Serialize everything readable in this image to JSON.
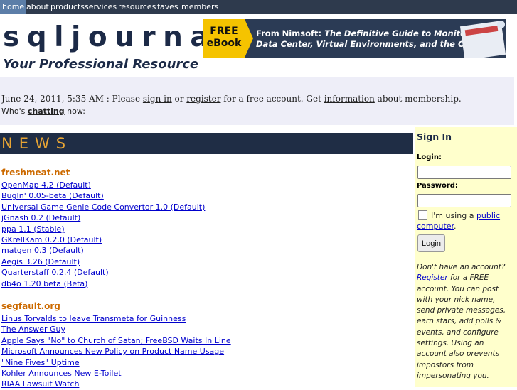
{
  "nav": {
    "items": [
      {
        "label": "home",
        "active": true
      },
      {
        "label": "about",
        "active": false
      },
      {
        "label": "products",
        "active": false
      },
      {
        "label": "services",
        "active": false
      },
      {
        "label": "resources",
        "active": false
      },
      {
        "label": "faves",
        "active": false
      },
      {
        "label": "members",
        "active": false
      }
    ]
  },
  "header": {
    "logo_text": "sqljournal",
    "tagline": "Your Professional Resource"
  },
  "banner": {
    "badge_line1": "FREE",
    "badge_line2": "eBook",
    "line1_prefix": "From Nimsoft: ",
    "line1_title": "The Definitive Guide to Monitoring the",
    "line2_title": "Data Center, Virtual Environments, and the Cloud",
    "close_icon": "ad-info-icon"
  },
  "info": {
    "date_text": "June 24, 2011, 5:35 AM : Please ",
    "sign_in": "sign in",
    "or_text": " or ",
    "register": "register",
    "free_text": " for a free account. Get ",
    "information": "information",
    "tail": " about membership.",
    "chat_prefix": "Who's ",
    "chatting": "chatting",
    "chat_suffix": " now:"
  },
  "news": {
    "title": "NEWS",
    "sections": [
      {
        "name": "freshmeat.net",
        "items": [
          "OpenMap 4.2 (Default)",
          "BugIn' 0.05-beta (Default)",
          "Universal Game Genie Code Convertor 1.0 (Default)",
          "jGnash 0.2 (Default)",
          "ppa 1.1 (Stable)",
          "GKrellKam 0.2.0 (Default)",
          "matgen 0.3 (Default)",
          "Aegis 3.26 (Default)",
          "Quarterstaff 0.2.4 (Default)",
          "db4o 1.20 beta (Beta)"
        ]
      },
      {
        "name": "segfault.org",
        "items": [
          "Linus Torvalds to leave Transmeta for Guinness",
          "The Answer Guy",
          "Apple Says \"No\" to Church of Satan; FreeBSD Waits In Line",
          "Microsoft Announces New Policy on Product Name Usage",
          "\"Nine Fives\" Uptime",
          "Kohler Announces New E-Toilet",
          "RIAA Lawsuit Watch"
        ]
      }
    ]
  },
  "signin": {
    "title": "Sign In",
    "login_label": "Login:",
    "password_label": "Password:",
    "remember_prefix": "I'm using a ",
    "public_computer": "public computer",
    "remember_suffix": ".",
    "login_button": "Login",
    "prompt": "Don't have an account?",
    "register_link": "Register",
    "body": " for a FREE account. You can post with your nick name, send private messages, earn stars, add polls & events, and configure settings. Using an account also prevents impostors from impersonating you."
  }
}
